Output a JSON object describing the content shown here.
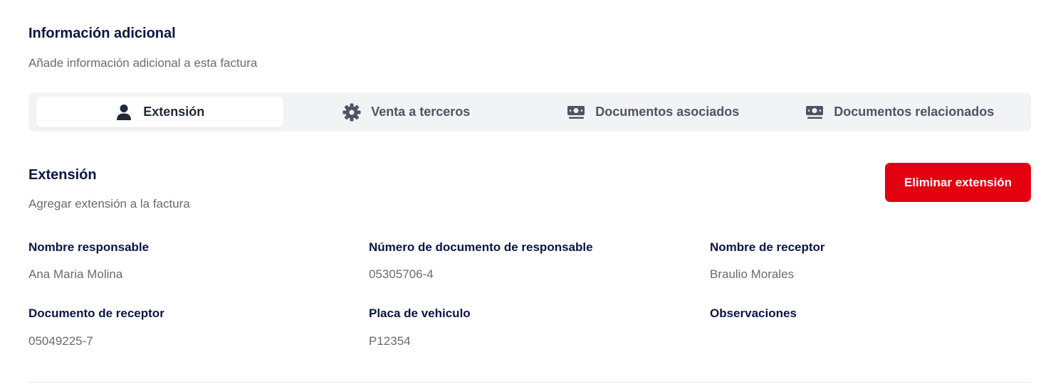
{
  "header": {
    "title": "Información adicional",
    "subtitle": "Añade información adicional a esta factura"
  },
  "tabs": [
    {
      "label": "Extensión",
      "icon": "user-icon",
      "active": true
    },
    {
      "label": "Venta a terceros",
      "icon": "gear-icon",
      "active": false
    },
    {
      "label": "Documentos asociados",
      "icon": "money-icon",
      "active": false
    },
    {
      "label": "Documentos relacionados",
      "icon": "money-icon",
      "active": false
    }
  ],
  "extension": {
    "title": "Extensión",
    "subtitle": "Agregar extensión a la factura",
    "delete_label": "Eliminar extensión"
  },
  "fields": [
    {
      "label": "Nombre responsable",
      "value": "Ana Maria Molina"
    },
    {
      "label": "Número de documento de responsable",
      "value": "05305706-4"
    },
    {
      "label": "Nombre de receptor",
      "value": "Braulio Morales"
    },
    {
      "label": "Documento de receptor",
      "value": "05049225-7"
    },
    {
      "label": "Placa de vehiculo",
      "value": "P12354"
    },
    {
      "label": "Observaciones",
      "value": ""
    }
  ],
  "colors": {
    "heading": "#0b1446",
    "muted": "#6b6b6b",
    "danger": "#e3000f",
    "tabs_bg": "#f2f3f5"
  }
}
